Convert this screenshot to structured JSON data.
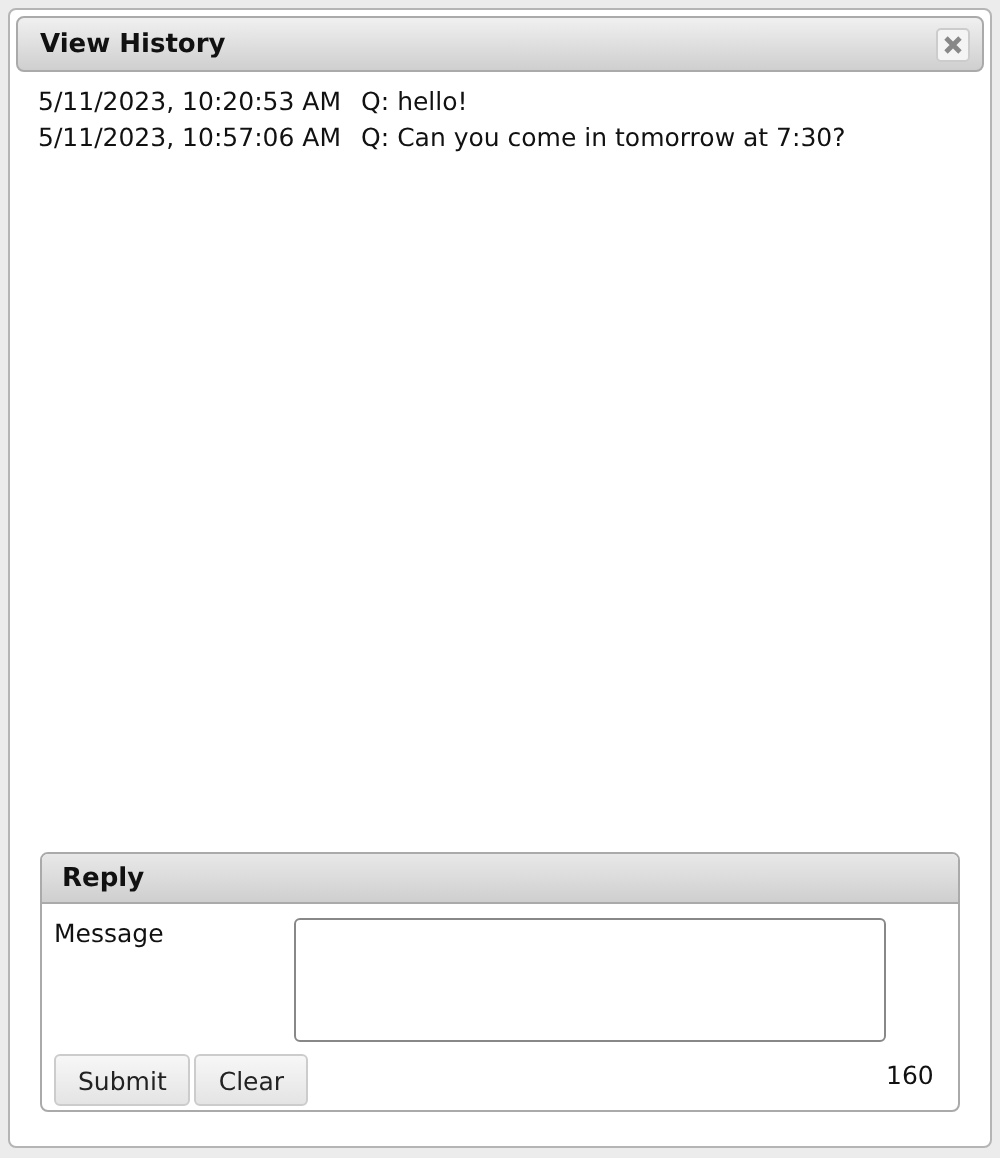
{
  "dialog": {
    "title": "View History"
  },
  "messages": [
    {
      "time": "5/11/2023, 10:20:53 AM",
      "prefix": "Q:",
      "text": "hello!"
    },
    {
      "time": "5/11/2023, 10:57:06 AM",
      "prefix": "Q:",
      "text": "Can you come in tomorrow at 7:30?"
    }
  ],
  "reply": {
    "title": "Reply",
    "message_label": "Message",
    "remaining": "160",
    "buttons": [
      "Submit",
      "Clear"
    ]
  }
}
